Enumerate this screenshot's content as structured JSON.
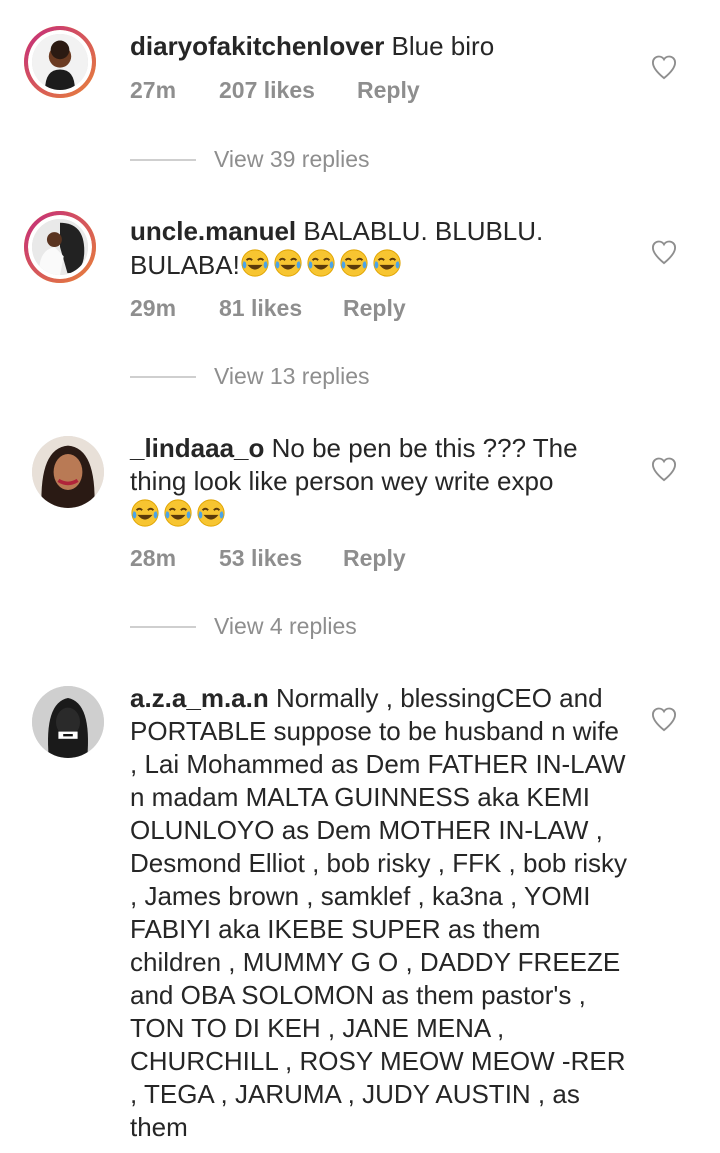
{
  "comments": [
    {
      "username": "diaryofakitchenlover",
      "text": " Blue biro",
      "time": "27m",
      "likes": "207 likes",
      "reply": "Reply",
      "view_replies": "View 39 replies",
      "has_story": true
    },
    {
      "username": "uncle.manuel",
      "text": " BALABLU.  BLUBLU. BULABA!",
      "emoji_count": 5,
      "time": "29m",
      "likes": "81 likes",
      "reply": "Reply",
      "view_replies": "View 13 replies",
      "has_story": true
    },
    {
      "username": "_lindaaa_o",
      "text": " No be pen be this ??? The thing look like person wey write expo",
      "emoji_count": 3,
      "time": "28m",
      "likes": "53 likes",
      "reply": "Reply",
      "view_replies": "View 4 replies",
      "has_story": false
    },
    {
      "username": "a.z.a_m.a.n",
      "text": " Normally , blessingCEO and PORTABLE suppose to be husband n wife , Lai Mohammed as Dem FATHER IN-LAW n madam MALTA GUINNESS aka KEMI OLUNLOYO as Dem MOTHER IN-LAW , Desmond Elliot , bob risky , FFK , bob risky , James brown , samklef , ka3na , YOMI FABIYI aka IKEBE SUPER as them children , MUMMY G O , DADDY FREEZE and OBA SOLOMON as them pastor's , TON TO DI KEH , JANE MENA , CHURCHILL , ROSY MEOW MEOW -RER , TEGA , JARUMA , JUDY AUSTIN , as them",
      "has_story": false
    }
  ],
  "icons": {
    "like": "heart-outline-icon",
    "emoji": "face-with-tears-of-joy"
  },
  "colors": {
    "text": "#262626",
    "muted": "#8e8e8e",
    "story_ring_start": "#c22a7f",
    "story_ring_end": "#e8823a"
  }
}
